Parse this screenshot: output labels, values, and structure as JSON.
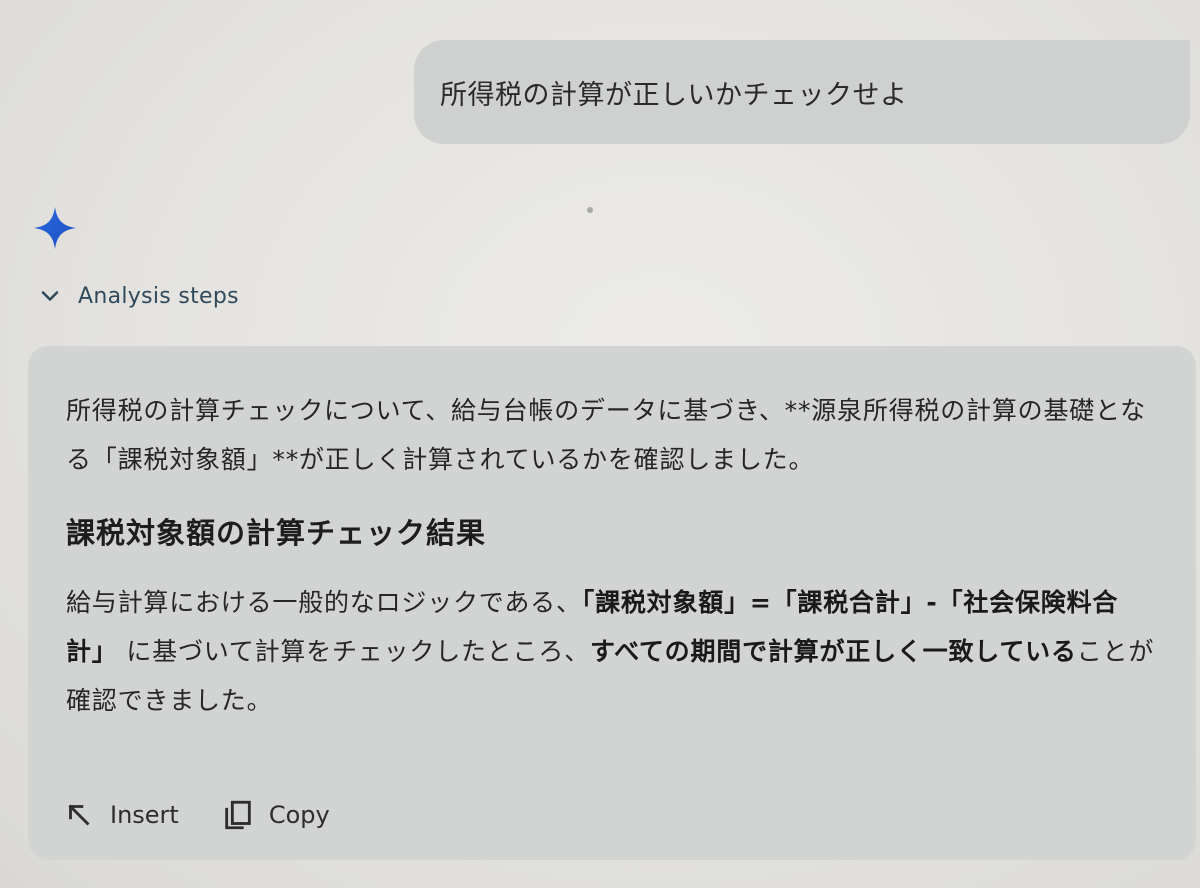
{
  "colors": {
    "accent_blue": "#1a5fd6",
    "link_teal": "#2f4a5c",
    "bubble": "#cfd0d0",
    "card": "#d2d3d3"
  },
  "user_message": {
    "text": "所得税の計算が正しいかチェックせよ"
  },
  "assistant": {
    "logo_icon": "gemini-sparkle-icon",
    "analysis_toggle": {
      "icon": "chevron-down-icon",
      "label": "Analysis steps"
    },
    "response": {
      "intro": "所得税の計算チェックについて、給与台帳のデータに基づき、**源泉所得税の計算の基礎となる「課税対象額」**が正しく計算されているかを確認しました。",
      "heading": "課税対象額の計算チェック結果",
      "body": {
        "part1": "給与計算における一般的なロジックである、",
        "bold1": "「課税対象額」=「課税合計」-「社会保険料合計」",
        "part2": " に基づいて計算をチェックしたところ、",
        "bold2": "すべての期間で計算が正しく一致している",
        "part3": "ことが確認できました。"
      }
    },
    "actions": {
      "insert": {
        "icon": "insert-arrow-icon",
        "label": "Insert"
      },
      "copy": {
        "icon": "copy-icon",
        "label": "Copy"
      }
    }
  }
}
